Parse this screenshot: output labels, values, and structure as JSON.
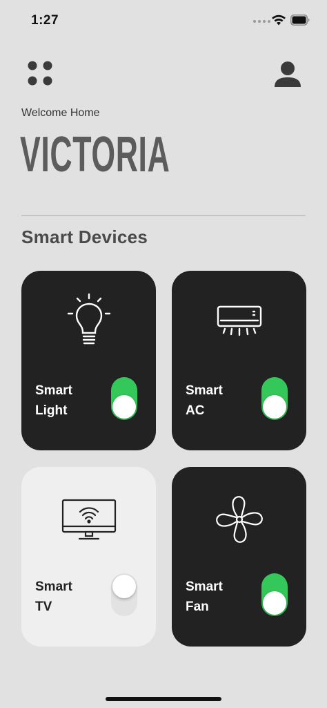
{
  "status_bar": {
    "time": "1:27"
  },
  "header": {
    "menu_icon": "grid-dots-icon",
    "profile_icon": "user-icon"
  },
  "greeting": {
    "welcome": "Welcome Home",
    "name": "VICTORIA"
  },
  "section": {
    "title": "Smart Devices"
  },
  "devices": [
    {
      "line1": "Smart",
      "line2": "Light",
      "icon": "lightbulb-icon",
      "on": true
    },
    {
      "line1": "Smart",
      "line2": "AC",
      "icon": "air-conditioner-icon",
      "on": true
    },
    {
      "line1": "Smart",
      "line2": "TV",
      "icon": "tv-icon",
      "on": false
    },
    {
      "line1": "Smart",
      "line2": "Fan",
      "icon": "fan-icon",
      "on": true
    }
  ],
  "colors": {
    "background": "#e1e1e1",
    "card_on": "#222222",
    "card_off": "#efefef",
    "toggle_on": "#34c759",
    "toggle_off": "#e2e2e2"
  }
}
